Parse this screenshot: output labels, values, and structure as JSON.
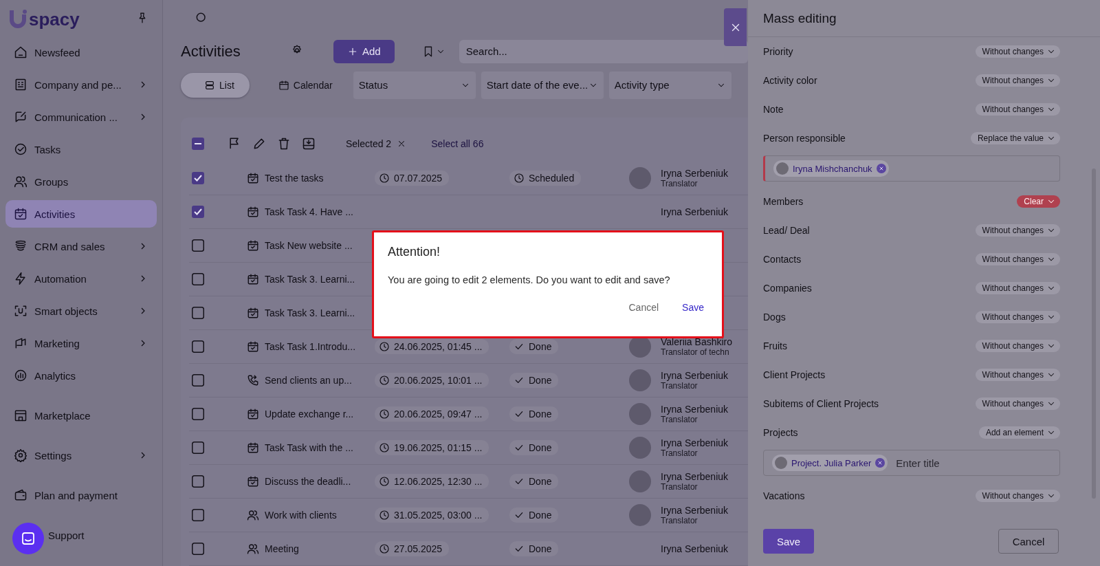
{
  "sidebar": {
    "logo": "spacy",
    "sections": [
      [
        {
          "label": "Newsfeed",
          "has_submenu": false,
          "selected": false
        },
        {
          "label": "Company and pe...",
          "has_submenu": true,
          "selected": false
        },
        {
          "label": "Communication ...",
          "has_submenu": true,
          "selected": false
        },
        {
          "label": "Tasks",
          "has_submenu": false,
          "selected": false
        },
        {
          "label": "Groups",
          "has_submenu": false,
          "selected": false
        },
        {
          "label": "Activities",
          "has_submenu": false,
          "selected": true
        },
        {
          "label": "CRM and sales",
          "has_submenu": true,
          "selected": false
        },
        {
          "label": "Automation",
          "has_submenu": true,
          "selected": false
        },
        {
          "label": "Smart objects",
          "has_submenu": true,
          "selected": false
        },
        {
          "label": "Marketing",
          "has_submenu": true,
          "selected": false
        },
        {
          "label": "Analytics",
          "has_submenu": false,
          "selected": false
        }
      ],
      [
        {
          "label": "Marketplace",
          "has_submenu": false,
          "selected": false
        }
      ],
      [
        {
          "label": "Settings",
          "has_submenu": true,
          "selected": false
        }
      ],
      [
        {
          "label": "Plan and payment",
          "has_submenu": false,
          "selected": false
        }
      ],
      [
        {
          "label": "Support",
          "has_submenu": false,
          "selected": false
        }
      ]
    ]
  },
  "page": {
    "title": "Activities",
    "add_button": "Add",
    "search": {
      "placeholder": "Search..."
    },
    "views": [
      {
        "label": "List",
        "selected": true
      },
      {
        "label": "Calendar",
        "selected": false
      }
    ],
    "filters": [
      "Status",
      "Start date of the eve...",
      "Activity type"
    ]
  },
  "table": {
    "header_checkbox": {
      "indeterminate": true
    },
    "selected_count": "Selected 2",
    "select_all": "Select all 66",
    "rows": [
      {
        "checked": true,
        "kind": "task",
        "title": "Test the tasks",
        "date": "07.07.2025",
        "status": "Scheduled",
        "done": false,
        "person": "Iryna Serbeniuk",
        "role": "Translator"
      },
      {
        "checked": true,
        "kind": "task",
        "title": "Task Task 4. Have ...",
        "person": "Iryna Serbeniuk"
      },
      {
        "checked": false,
        "kind": "task",
        "title": "Task New website ..."
      },
      {
        "checked": false,
        "kind": "task",
        "title": "Task Task 3. Learni..."
      },
      {
        "checked": false,
        "kind": "task",
        "title": "Task Task 3. Learni..."
      },
      {
        "checked": false,
        "kind": "task",
        "title": "Task Task 1.Introdu...",
        "date": "24.06.2025, 01:45 ...",
        "status": "Done",
        "done": true,
        "person": "Valeriia Bashkiro",
        "role": "Translator of techn"
      },
      {
        "checked": false,
        "kind": "call",
        "title": "Send clients an up...",
        "date": "20.06.2025, 10:01 ...",
        "status": "Done",
        "done": true,
        "person": "Iryna Serbeniuk",
        "role": "Translator"
      },
      {
        "checked": false,
        "kind": "task",
        "title": "Update exchange r...",
        "date": "20.06.2025, 09:47 ...",
        "status": "Done",
        "done": true,
        "person": "Iryna Serbeniuk",
        "role": "Translator"
      },
      {
        "checked": false,
        "kind": "task",
        "title": "Task Task with the ...",
        "date": "19.06.2025, 01:15 ...",
        "status": "Done",
        "done": true,
        "person": "Iryna Serbeniuk",
        "role": "Translator"
      },
      {
        "checked": false,
        "kind": "task",
        "title": "Discuss the deadli...",
        "date": "12.06.2025, 12:30 ...",
        "status": "Done",
        "done": true,
        "person": "Iryna Serbeniuk",
        "role": "Translator"
      },
      {
        "checked": false,
        "kind": "meeting",
        "title": "Work with clients",
        "date": "31.05.2025, 03:00 ...",
        "status": "Done",
        "done": true,
        "person": "Iryna Serbeniuk",
        "role": "Translator"
      },
      {
        "checked": false,
        "kind": "meeting",
        "title": "Meeting",
        "date": "27.05.2025",
        "status": "Done",
        "done": true,
        "person": "Iryna Serbeniuk"
      }
    ]
  },
  "drawer": {
    "title": "Mass editing",
    "fields": [
      {
        "label": "Priority",
        "value": "Without changes",
        "kind": "default"
      },
      {
        "label": "Activity color",
        "value": "Without changes",
        "kind": "default"
      },
      {
        "label": "Note",
        "value": "Without changes",
        "kind": "default"
      },
      {
        "label": "Person responsible",
        "value": "Replace the value",
        "kind": "default",
        "chips": [
          "Iryna Mishchanchuk"
        ],
        "error": true
      },
      {
        "label": "Members",
        "value": "Clear",
        "kind": "danger"
      },
      {
        "label": "Lead/ Deal",
        "value": "Without changes",
        "kind": "default"
      },
      {
        "label": "Contacts",
        "value": "Without changes",
        "kind": "default"
      },
      {
        "label": "Companies",
        "value": "Without changes",
        "kind": "default"
      },
      {
        "label": "Dogs",
        "value": "Without changes",
        "kind": "default"
      },
      {
        "label": "Fruits",
        "value": "Without changes",
        "kind": "default"
      },
      {
        "label": "Client Projects",
        "value": "Without changes",
        "kind": "default"
      },
      {
        "label": "Subitems of Client Projects",
        "value": "Without changes",
        "kind": "default"
      },
      {
        "label": "Projects",
        "value": "Add an element",
        "kind": "default",
        "chips": [
          "Project. Julia Parker"
        ],
        "placeholder": "Enter title",
        "error": false
      },
      {
        "label": "Vacations",
        "value": "Without changes",
        "kind": "default"
      }
    ],
    "save": "Save",
    "cancel": "Cancel"
  },
  "dialog": {
    "title": "Attention!",
    "message": "You are going to edit 2 elements. Do you want to edit and save?",
    "cancel": "Cancel",
    "save": "Save"
  }
}
